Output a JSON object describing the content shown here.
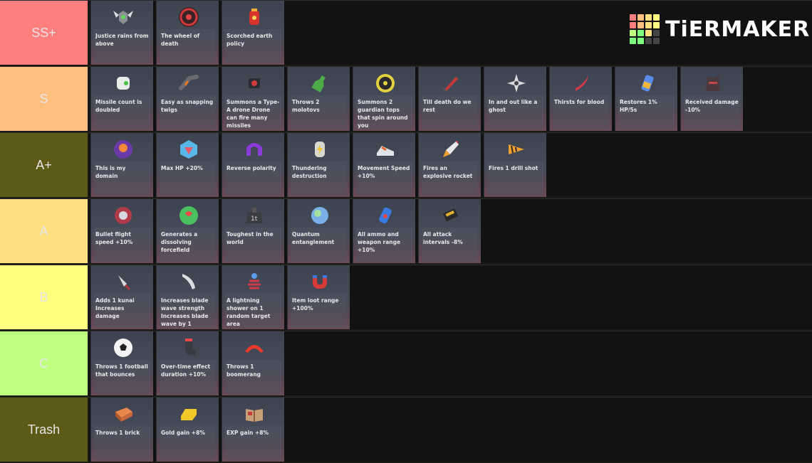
{
  "logo": {
    "text": "TiERMAKER",
    "grid_colors": [
      "#ff7f7f",
      "#ffbf7f",
      "#ffdf7f",
      "#ffff7f",
      "#ff7f7f",
      "#ffbf7f",
      "#ffdf7f",
      "#ffff7f",
      "#bfff7f",
      "#7fff7f",
      "#ffdf7f",
      "#444444",
      "#7fff7f",
      "#7fff7f",
      "#444444",
      "#444444"
    ]
  },
  "tiers": [
    {
      "label": "SS+",
      "color": "#ff7f7f",
      "items": [
        {
          "icon": "winged-shield-icon",
          "desc": "Justice rains from above"
        },
        {
          "icon": "target-wheel-icon",
          "desc": "The wheel of death"
        },
        {
          "icon": "fire-canister-icon",
          "desc": "Scorched earth policy"
        }
      ]
    },
    {
      "label": "S",
      "color": "#ffbf7f",
      "items": [
        {
          "icon": "missile-pod-icon",
          "desc": "Missile count is doubled"
        },
        {
          "icon": "bent-pipe-icon",
          "desc": "Easy as snapping twigs"
        },
        {
          "icon": "drone-icon",
          "desc": "Summons a Type-A drone Drone can fire many missiles"
        },
        {
          "icon": "molotov-icon",
          "desc": "Throws 2 molotovs"
        },
        {
          "icon": "guardian-top-icon",
          "desc": "Summons 2 guardian tops that spin around you"
        },
        {
          "icon": "red-blade-icon",
          "desc": "Till death do we rest"
        },
        {
          "icon": "shuriken-icon",
          "desc": "In and out like a ghost"
        },
        {
          "icon": "curved-sword-icon",
          "desc": "Thirsts for blood"
        },
        {
          "icon": "hp-drink-icon",
          "desc": "Restores 1% HP/5s"
        },
        {
          "icon": "armor-vest-icon",
          "desc": "Received damage -10%"
        }
      ]
    },
    {
      "label": "A+",
      "color": "#5c5a16",
      "items": [
        {
          "icon": "domain-orb-icon",
          "desc": "This is my domain"
        },
        {
          "icon": "hp-cube-icon",
          "desc": "Max HP +20%"
        },
        {
          "icon": "polarity-magnet-icon",
          "desc": "Reverse polarity"
        },
        {
          "icon": "thunder-canister-icon",
          "desc": "Thundering destruction"
        },
        {
          "icon": "sneaker-icon",
          "desc": "Movement Speed +10%"
        },
        {
          "icon": "rocket-icon",
          "desc": "Fires an explosive rocket"
        },
        {
          "icon": "drill-icon",
          "desc": "Fires 1 drill shot"
        }
      ]
    },
    {
      "label": "A",
      "color": "#ffdf7f",
      "items": [
        {
          "icon": "bullet-drum-icon",
          "desc": "Bullet flight speed +10%"
        },
        {
          "icon": "forcefield-icon",
          "desc": "Generates a dissolving forcefield"
        },
        {
          "icon": "weight-icon",
          "desc": "Toughest in the world"
        },
        {
          "icon": "quantum-orb-icon",
          "desc": "Quantum entanglement"
        },
        {
          "icon": "ammo-flask-icon",
          "desc": "All ammo and weapon range +10%"
        },
        {
          "icon": "ammo-clip-icon",
          "desc": "All attack intervals -8%"
        }
      ]
    },
    {
      "label": "B",
      "color": "#ffff7f",
      "items": [
        {
          "icon": "kunai-icon",
          "desc": "Adds 1 kunai Increases damage"
        },
        {
          "icon": "blade-icon",
          "desc": "Increases blade wave strength Increases blade wave by 1"
        },
        {
          "icon": "lightning-coil-icon",
          "desc": "A lightning shower on 1 random target area"
        },
        {
          "icon": "loot-magnet-icon",
          "desc": "Item loot range +100%"
        }
      ]
    },
    {
      "label": "C",
      "color": "#bfff7f",
      "items": [
        {
          "icon": "football-icon",
          "desc": "Throws 1 football that bounces"
        },
        {
          "icon": "sock-icon",
          "desc": "Over-time effect duration +10%"
        },
        {
          "icon": "boomerang-icon",
          "desc": "Throws 1 boomerang"
        }
      ]
    },
    {
      "label": "Trash",
      "color": "#5c5a16",
      "items": [
        {
          "icon": "brick-icon",
          "desc": "Throws 1 brick"
        },
        {
          "icon": "gold-bar-icon",
          "desc": "Gold gain +8%"
        },
        {
          "icon": "exp-book-icon",
          "desc": "EXP gain +8%"
        }
      ]
    }
  ]
}
